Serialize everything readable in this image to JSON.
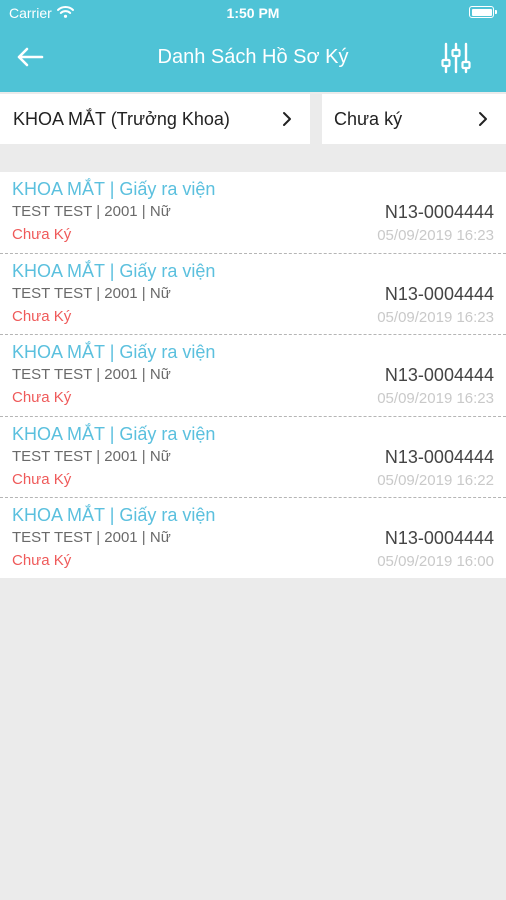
{
  "status_bar": {
    "carrier": "Carrier",
    "time": "1:50 PM"
  },
  "header": {
    "title": "Danh Sách Hồ Sơ Ký"
  },
  "filters": {
    "department": "KHOA MẮT (Trưởng Khoa)",
    "status": "Chưa ký"
  },
  "records": [
    {
      "title": "KHOA MẮT | Giấy ra viện",
      "patient": "TEST TEST | 2001 |  Nữ",
      "status": "Chưa Ký",
      "code": "N13-0004444",
      "date": "05/09/2019 16:23"
    },
    {
      "title": "KHOA MẮT | Giấy ra viện",
      "patient": "TEST TEST | 2001 |  Nữ",
      "status": "Chưa Ký",
      "code": "N13-0004444",
      "date": "05/09/2019 16:23"
    },
    {
      "title": "KHOA MẮT | Giấy ra viện",
      "patient": "TEST TEST | 2001 |  Nữ",
      "status": "Chưa Ký",
      "code": "N13-0004444",
      "date": "05/09/2019 16:23"
    },
    {
      "title": "KHOA MẮT | Giấy ra viện",
      "patient": "TEST TEST | 2001 |  Nữ",
      "status": "Chưa Ký",
      "code": "N13-0004444",
      "date": "05/09/2019 16:22"
    },
    {
      "title": "KHOA MẮT | Giấy ra viện",
      "patient": "TEST TEST | 2001 |  Nữ",
      "status": "Chưa Ký",
      "code": "N13-0004444",
      "date": "05/09/2019 16:00"
    }
  ],
  "colors": {
    "header": "#4fc3d6",
    "title_text": "#5bc0de",
    "status_text": "#ef5a5a",
    "background": "#ebebeb"
  },
  "icons": {
    "back": "arrow-left-icon",
    "filter": "sliders-icon",
    "chevron": "chevron-right-icon",
    "wifi": "wifi-icon",
    "battery": "battery-icon"
  }
}
